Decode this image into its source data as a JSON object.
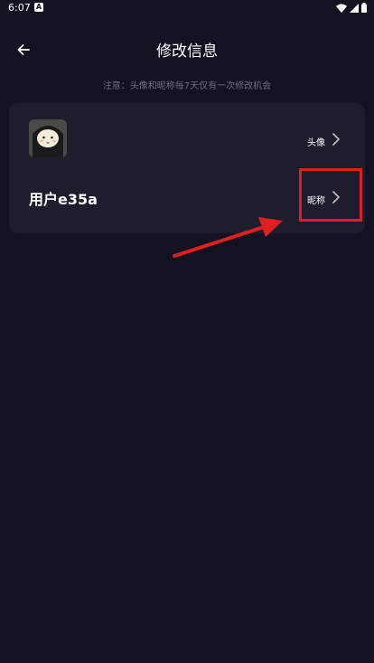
{
  "status_bar": {
    "time": "6:07",
    "left_icon": "a-icon",
    "right_icons": [
      "wifi-icon",
      "signal-icon",
      "battery-icon"
    ]
  },
  "header": {
    "back_icon": "back-arrow-icon",
    "title": "修改信息"
  },
  "notice": "注意：头像和昵称每7天仅有一次修改机会",
  "card": {
    "avatar_row": {
      "label": "头像",
      "chevron_icon": "chevron-right-icon"
    },
    "nickname_row": {
      "value": "用户e35a",
      "label": "昵称",
      "chevron_icon": "chevron-right-icon"
    }
  },
  "colors": {
    "background": "#121220",
    "card": "#1d1d2b",
    "notice_text": "#6e6e80",
    "annotation": "#e02020"
  }
}
